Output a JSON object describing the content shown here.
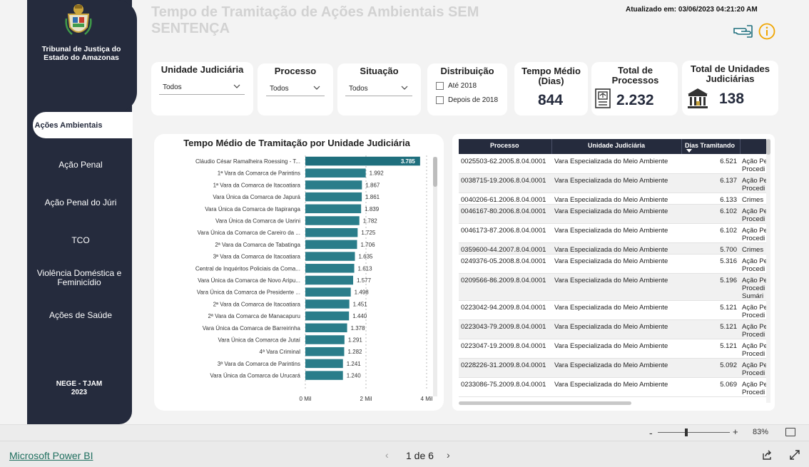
{
  "sidebar": {
    "org_name": "Tribunal de Justiça do Estado do Amazonas",
    "active_item": "Ações Ambientais",
    "items": [
      {
        "label": "Ação Penal"
      },
      {
        "label": "Ação Penal do Júri"
      },
      {
        "label": "TCO"
      },
      {
        "label": "Violência Doméstica e Feminicídio"
      },
      {
        "label": "Ações de Saúde"
      }
    ],
    "footer": "NEGE - TJAM 2023"
  },
  "header": {
    "title": "Tempo de Tramitação de Ações Ambientais SEM SENTENÇA",
    "updated": "Atualizado em: 03/06/2023 04:21:20  AM"
  },
  "filters": {
    "unidade": {
      "title": "Unidade Judiciária",
      "value": "Todos"
    },
    "processo": {
      "title": "Processo",
      "value": "Todos"
    },
    "situacao": {
      "title": "Situação",
      "value": "Todos"
    },
    "distribuicao": {
      "title": "Distribuição",
      "options": [
        "Até 2018",
        "Depois de 2018"
      ]
    }
  },
  "kpis": {
    "tempo": {
      "title": "Tempo Médio (Dias)",
      "value": "844"
    },
    "processos": {
      "title": "Total de Processos",
      "value": "2.232"
    },
    "unidades": {
      "title": "Total de Unidades Judiciárias",
      "value": "138"
    }
  },
  "chart_data": {
    "type": "bar",
    "orientation": "horizontal",
    "title": "Tempo Médio de Tramitação por Unidade Judiciária",
    "categories": [
      "Cláudio César Ramalheira Roessing - T...",
      "1ª Vara da Comarca de Parintins",
      "1ª Vara da Comarca de Itacoatiara",
      "Vara Única da Comarca de Japurá",
      "Vara Única da Comarca de Itapiranga",
      "Vara Única da Comarca de Uarini",
      "Vara Única da Comarca de Careiro da ...",
      "2ª Vara da Comarca de Tabatinga",
      "3ª Vara da Comarca de Itacoatiara",
      "Central de Inquéritos Policiais da Coma...",
      "Vara Única da Comarca de Novo Aripu...",
      "Vara Única da Comarca de Presidente ...",
      "2ª Vara da Comarca de Itacoatiara",
      "2ª Vara da Comarca de Manacapuru",
      "Vara Única da Comarca de Barreirinha",
      "Vara Única da Comarca de Jutaí",
      "4ª Vara Criminal",
      "3ª Vara da Comarca de Parintins",
      "Vara Única da Comarca de Urucará"
    ],
    "values": [
      3785,
      1992,
      1867,
      1861,
      1839,
      1782,
      1725,
      1706,
      1635,
      1613,
      1577,
      1498,
      1451,
      1440,
      1378,
      1291,
      1282,
      1241,
      1240
    ],
    "value_labels": [
      "3.785",
      "1.992",
      "1.867",
      "1.861",
      "1.839",
      "1.782",
      "1.725",
      "1.706",
      "1.635",
      "1.613",
      "1.577",
      "1.498",
      "1.451",
      "1.440",
      "1.378",
      "1.291",
      "1.282",
      "1.241",
      "1.240"
    ],
    "xlim": [
      0,
      4000
    ],
    "xticks": [
      "0 Mil",
      "2 Mil",
      "4 Mil"
    ],
    "bar_color": "#2a7d8a",
    "highlight_color": "#1f6f7d"
  },
  "table": {
    "columns": [
      "Processo",
      "Unidade Judiciária",
      "Dias Tramitando",
      ""
    ],
    "rows": [
      {
        "processo": "0025503-62.2005.8.04.0001",
        "unidade": "Vara Especializada do Meio Ambiente",
        "dias": "6.521",
        "classe": [
          "Ação Pe",
          "Procedi"
        ]
      },
      {
        "processo": "0038715-19.2006.8.04.0001",
        "unidade": "Vara Especializada do Meio Ambiente",
        "dias": "6.137",
        "classe": [
          "Ação Pe",
          "Procedi"
        ]
      },
      {
        "processo": "0040206-61.2006.8.04.0001",
        "unidade": "Vara Especializada do Meio Ambiente",
        "dias": "6.133",
        "classe": [
          "Crimes"
        ]
      },
      {
        "processo": "0046167-80.2006.8.04.0001",
        "unidade": "Vara Especializada do Meio Ambiente",
        "dias": "6.102",
        "classe": [
          "Ação Pe",
          "Procedi"
        ]
      },
      {
        "processo": "0046173-87.2006.8.04.0001",
        "unidade": "Vara Especializada do Meio Ambiente",
        "dias": "6.102",
        "classe": [
          "Ação Pe",
          "Procedi"
        ]
      },
      {
        "processo": "0359600-44.2007.8.04.0001",
        "unidade": "Vara Especializada do Meio Ambiente",
        "dias": "5.700",
        "classe": [
          "Crimes"
        ]
      },
      {
        "processo": "0249376-05.2008.8.04.0001",
        "unidade": "Vara Especializada do Meio Ambiente",
        "dias": "5.316",
        "classe": [
          "Ação Pe",
          "Procedi"
        ]
      },
      {
        "processo": "0209566-86.2009.8.04.0001",
        "unidade": "Vara Especializada do Meio Ambiente",
        "dias": "5.196",
        "classe": [
          "Ação Pe",
          "Procedi",
          "Sumári"
        ]
      },
      {
        "processo": "0223042-94.2009.8.04.0001",
        "unidade": "Vara Especializada do Meio Ambiente",
        "dias": "5.121",
        "classe": [
          "Ação Pe",
          "Procedi"
        ]
      },
      {
        "processo": "0223043-79.2009.8.04.0001",
        "unidade": "Vara Especializada do Meio Ambiente",
        "dias": "5.121",
        "classe": [
          "Ação Pe",
          "Procedi"
        ]
      },
      {
        "processo": "0223047-19.2009.8.04.0001",
        "unidade": "Vara Especializada do Meio Ambiente",
        "dias": "5.121",
        "classe": [
          "Ação Pe",
          "Procedi"
        ]
      },
      {
        "processo": "0228226-31.2009.8.04.0001",
        "unidade": "Vara Especializada do Meio Ambiente",
        "dias": "5.092",
        "classe": [
          "Ação Pe",
          "Procedi"
        ]
      },
      {
        "processo": "0233086-75.2009.8.04.0001",
        "unidade": "Vara Especializada do Meio Ambiente",
        "dias": "5.069",
        "classe": [
          "Ação Pe",
          "Procedi"
        ]
      }
    ]
  },
  "zoom": {
    "minus": "-",
    "plus": "+",
    "level": "83%"
  },
  "footer": {
    "brand": "Microsoft Power BI",
    "page": "1 de 6",
    "prev": "‹",
    "next": "›"
  }
}
